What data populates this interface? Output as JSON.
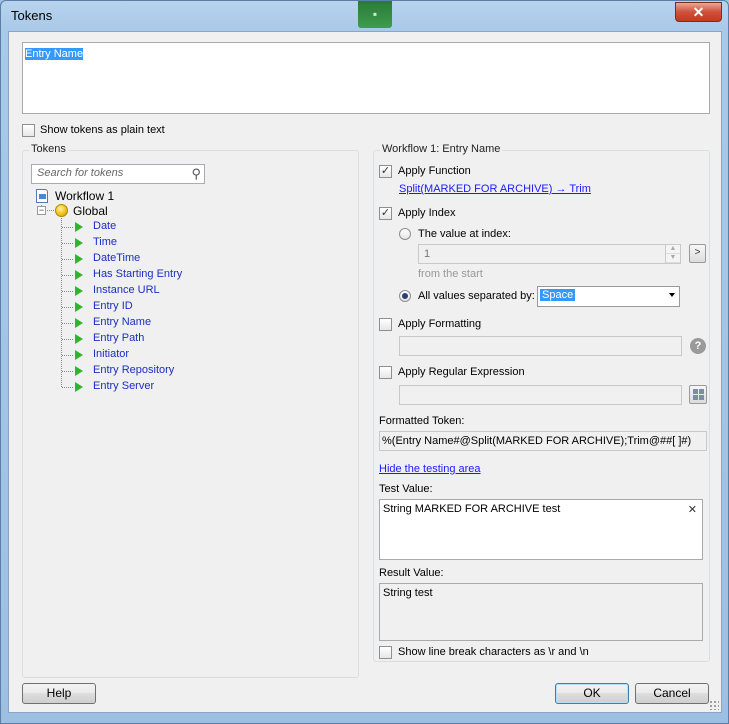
{
  "window": {
    "title": "Tokens",
    "close_glyph": "✕",
    "accent_glyph": "▪"
  },
  "entry_box": {
    "value": "Entry Name"
  },
  "show_plain_text": {
    "label": "Show tokens as plain text",
    "checked": false
  },
  "tokens_panel": {
    "title": "Tokens",
    "search_placeholder": "Search for tokens",
    "tree": {
      "root": "Workflow 1",
      "group": "Global",
      "group_expand_glyph": "−",
      "items": [
        "Date",
        "Time",
        "DateTime",
        "Has Starting Entry",
        "Instance URL",
        "Entry ID",
        "Entry Name",
        "Entry Path",
        "Initiator",
        "Entry Repository",
        "Entry Server"
      ]
    }
  },
  "config_panel": {
    "title": "Workflow 1: Entry Name",
    "apply_function": {
      "label": "Apply Function",
      "checked": true,
      "link": "Split(MARKED FOR ARCHIVE) → Trim"
    },
    "apply_index": {
      "label": "Apply Index",
      "checked": true,
      "value_at_index_label": "The value at index:",
      "index_value": "1",
      "from_label": "from the  start",
      "go_button": ">",
      "all_values_label": "All values separated by:",
      "separator_value": "Space",
      "selected_mode": "all_values"
    },
    "apply_formatting": {
      "label": "Apply Formatting",
      "checked": false,
      "help_glyph": "?"
    },
    "apply_regex": {
      "label": "Apply Regular Expression",
      "checked": false
    },
    "formatted_token": {
      "label": "Formatted Token:",
      "value": "%(Entry Name#@Split(MARKED FOR ARCHIVE);Trim@##[ ]#)"
    },
    "hide_testing_link": "Hide the testing area",
    "test_value": {
      "label": "Test Value:",
      "value": "String MARKED FOR ARCHIVE test",
      "clear_glyph": "✕"
    },
    "result_value": {
      "label": "Result Value:",
      "value": "String test"
    },
    "show_line_breaks": {
      "label": "Show line break characters as \\r and \\n",
      "checked": false
    }
  },
  "buttons": {
    "help": "Help",
    "ok": "OK",
    "cancel": "Cancel"
  },
  "check_glyph": "✓",
  "search_glyph": "⚲"
}
